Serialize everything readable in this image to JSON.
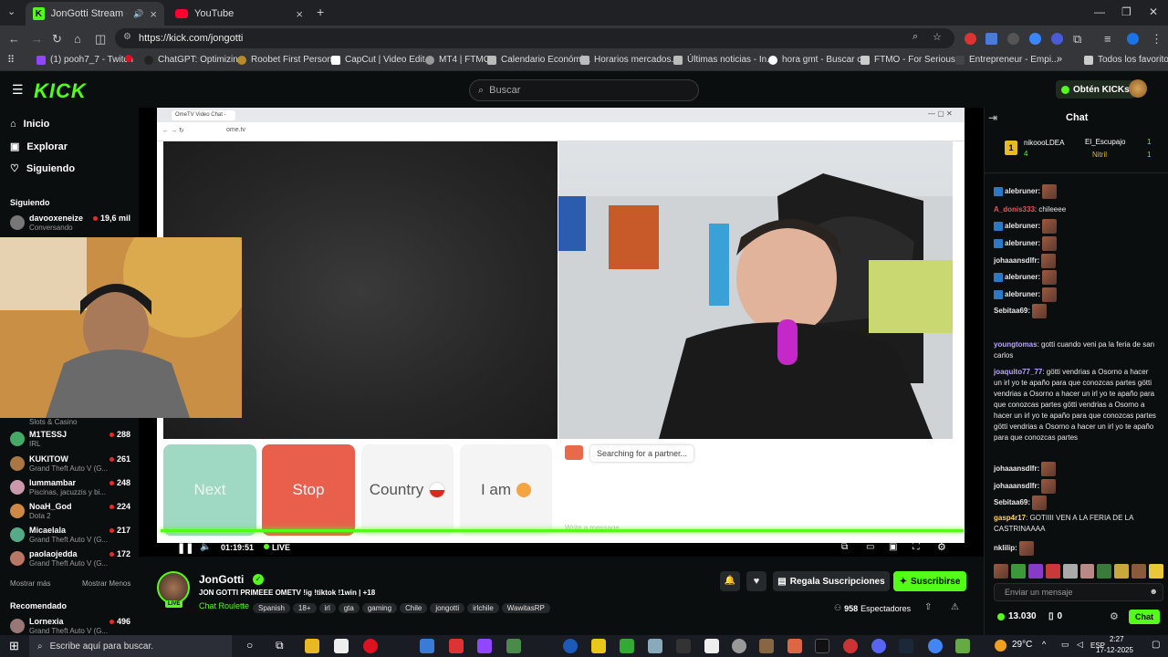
{
  "browser": {
    "tabs": [
      {
        "title": "JonGotti Stream - Watch L",
        "active": true
      },
      {
        "title": "YouTube",
        "active": false
      }
    ],
    "new_tab": "+",
    "url": "https://kick.com/jongotti",
    "bookmarks": [
      "(1) pooh7_7 - Twitch",
      "ChatGPT: Optimizin...",
      "Roobet First Person...",
      "CapCut | Video Edit...",
      "MT4 | FTMO",
      "Calendario Económi...",
      "Horarios mercados...",
      "Últimas noticias - In...",
      "hora gmt - Buscar c...",
      "FTMO - For Serious...",
      "Entrepreneur - Empi..."
    ],
    "bookmarks_more": "»",
    "all_favorites": "Todos los favoritos"
  },
  "kick": {
    "logo": "KICK",
    "search_placeholder": "Buscar",
    "kicks_button": "Obtén KICKs",
    "nav": [
      {
        "label": "Inicio",
        "icon": "home-icon"
      },
      {
        "label": "Explorar",
        "icon": "compass-icon"
      },
      {
        "label": "Siguiendo",
        "icon": "heart-icon"
      }
    ],
    "following_title": "Siguiendo",
    "following": [
      {
        "name": "davooxeneize",
        "sub": "Conversando",
        "viewers": "19,6 mil"
      }
    ],
    "following_more": [
      {
        "name": "M1TESSJ",
        "sub": "IRL",
        "viewers": "288"
      },
      {
        "name": "KUKITOW",
        "sub": "Grand Theft Auto V (G...",
        "viewers": "261"
      },
      {
        "name": "lummambar",
        "sub": "Piscinas, jacuzzis y bi...",
        "viewers": "248"
      },
      {
        "name": "NoaH_God",
        "sub": "Dota 2",
        "viewers": "224"
      },
      {
        "name": "Micaelala",
        "sub": "Grand Theft Auto V (G...",
        "viewers": "217"
      },
      {
        "name": "paolaojedda",
        "sub": "Grand Theft Auto V (G...",
        "viewers": "172"
      }
    ],
    "partial_sub": "Slots & Casino",
    "show_more": "Mostrar más",
    "show_less": "Mostrar Menos",
    "recommended_title": "Recomendado",
    "recommended": [
      {
        "name": "Lornexia",
        "sub": "Grand Theft Auto V (G...",
        "viewers": "496"
      }
    ]
  },
  "omegle": {
    "tab_title": "OmeTV Video Chat -",
    "url": "ome.tv",
    "buttons": {
      "next": "Next",
      "stop": "Stop",
      "country": "Country",
      "iam": "I am"
    },
    "searching": "Searching for a partner...",
    "message_placeholder": "Write a message"
  },
  "player": {
    "time": "01:19:51",
    "live": "LIVE"
  },
  "stream": {
    "streamer": "JonGotti",
    "live_badge": "LIVE",
    "title": "JON GOTTI PRIMEEE OMETV !ig !tiktok !1win | +18",
    "category": "Chat Roulette",
    "tags": [
      "Spanish",
      "18+",
      "irl",
      "gta",
      "gaming",
      "Chile",
      "jongotti",
      "irlchile",
      "WawitasRP"
    ],
    "gift_button": "Regala Suscripciones",
    "subscribe_button": "Suscribirse",
    "viewers": "958",
    "viewers_label": "Espectadores"
  },
  "chat": {
    "title": "Chat",
    "leaderboard": [
      {
        "rank": "1",
        "name": "nikoooLDEA",
        "count": "4"
      },
      {
        "name": "El_Escupajo",
        "count": "1"
      },
      {
        "name": "Nitril",
        "count": "1"
      }
    ],
    "messages": [
      {
        "user": "alebruner:",
        "text": "",
        "emote": true,
        "color": "#cfcfcf"
      },
      {
        "user": "A_donis333",
        "text": ": chileeee",
        "emote": false,
        "color": "#e0595b"
      },
      {
        "user": "alebruner:",
        "text": "",
        "emote": true,
        "color": "#cfcfcf"
      },
      {
        "user": "alebruner:",
        "text": "",
        "emote": true,
        "color": "#cfcfcf"
      },
      {
        "user": "johaaansdlfr:",
        "text": "",
        "emote": true,
        "color": "#cfcfcf"
      },
      {
        "user": "alebruner:",
        "text": "",
        "emote": true,
        "color": "#cfcfcf"
      },
      {
        "user": "alebruner:",
        "text": "",
        "emote": true,
        "color": "#cfcfcf"
      },
      {
        "user": "Sebitaa69:",
        "text": "",
        "emote": true,
        "color": "#cfcfcf"
      },
      {
        "user": "youngtomas",
        "text": ": gotti cuando veni pa la feria de san carlos",
        "emote": false,
        "color": "#b9a6ff"
      },
      {
        "user": "joaquito77_77",
        "text": ": götti vendrias a Osorno a hacer un irl yo te apaño para que conozcas partes götti vendrias a Osorno a hacer un irl yo te apaño para que conozcas partes götti vendrias a Osorno a hacer un irl yo te apaño para que conozcas partes götti vendrias a Osorno a hacer un irl yo te apaño para que conozcas partes",
        "emote": false,
        "color": "#b9a6ff"
      },
      {
        "user": "johaaansdlfr:",
        "text": "",
        "emote": true,
        "color": "#cfcfcf"
      },
      {
        "user": "johaaansdlfr:",
        "text": "",
        "emote": true,
        "color": "#cfcfcf"
      },
      {
        "user": "Sebitaa69:",
        "text": "",
        "emote": true,
        "color": "#cfcfcf"
      },
      {
        "user": "gasp4r17",
        "text": ": GOTIIII VEN A LA FERIA DE LA CASTRINAAAA",
        "emote": false,
        "color": "#ffd36a"
      },
      {
        "user": "nklilip:",
        "text": "",
        "emote": true,
        "color": "#cfcfcf"
      }
    ],
    "input_placeholder": "Enviar un mensaje",
    "kicks_balance": "13.030",
    "points": "0",
    "send_button": "Chat"
  },
  "taskbar": {
    "search_placeholder": "Escribe aquí para buscar.",
    "weather": "29°C",
    "language": "ESP",
    "time": "2:27",
    "date": "17-12-2025"
  },
  "colors": {
    "kick_green": "#53fc18",
    "stop_red": "#e8604c",
    "next_teal": "#9fd8c3"
  }
}
